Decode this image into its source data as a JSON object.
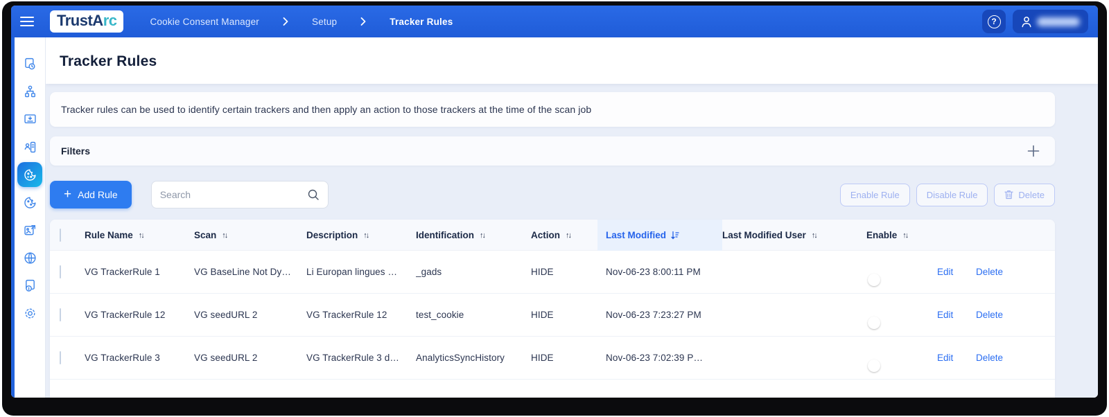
{
  "colors": {
    "navbar_blue": "#2263dc",
    "accent_blue": "#2e7cf0",
    "link_blue": "#2b6ef2",
    "active_sort_blue": "#2563eb",
    "sidebar_icon_blue": "#3f86ea"
  },
  "navbar": {
    "logo_part1": "TrustA",
    "logo_part2": "rc",
    "breadcrumb": [
      "Cookie Consent Manager",
      "Setup",
      "Tracker Rules"
    ],
    "help_glyph": "?"
  },
  "sidebar": {
    "items": [
      {
        "icon": "report-clock-icon",
        "active": false
      },
      {
        "icon": "sitemap-icon",
        "active": false
      },
      {
        "icon": "banner-download-icon",
        "active": false
      },
      {
        "icon": "audit-person-icon",
        "active": false
      },
      {
        "icon": "cookie-icon",
        "active": true
      },
      {
        "icon": "cookie-rules-icon",
        "active": false
      },
      {
        "icon": "export-card-icon",
        "active": false
      },
      {
        "icon": "globe-icon",
        "active": false
      },
      {
        "icon": "document-info-icon",
        "active": false
      },
      {
        "icon": "settings-gear-icon",
        "active": false
      }
    ]
  },
  "page": {
    "title": "Tracker Rules",
    "banner": "Tracker rules can be used to identify certain trackers and then apply an action to those trackers at the time of the scan job",
    "filters_label": "Filters",
    "filters_expand_glyph": "+"
  },
  "toolbar": {
    "add_rule_label": "Add Rule",
    "add_rule_plus": "+",
    "search_placeholder": "Search",
    "enable_rule_label": "Enable Rule",
    "disable_rule_label": "Disable Rule",
    "delete_label": "Delete"
  },
  "table": {
    "headers": [
      "Rule Name",
      "Scan",
      "Description",
      "Identification",
      "Action",
      "Last Modified",
      "Last Modified User",
      "Enable"
    ],
    "sort_glyph": "↑↓",
    "sorted_column": "Last Modified",
    "sort_direction": "desc",
    "row_actions": {
      "edit": "Edit",
      "delete": "Delete"
    },
    "rows": [
      {
        "rule_name": "VG TrackerRule 1",
        "scan": "VG BaseLine Not Dy…",
        "description": "Li Europan lingues …",
        "identification": "_gads",
        "action": "HIDE",
        "last_modified": "Nov-06-23 8:00:11 PM",
        "enabled": false
      },
      {
        "rule_name": "VG TrackerRule 12",
        "scan": "VG seedURL 2",
        "description": "VG TrackerRule 12",
        "identification": "test_cookie",
        "action": "HIDE",
        "last_modified": "Nov-06-23 7:23:27 PM",
        "enabled": false
      },
      {
        "rule_name": "VG TrackerRule 3",
        "scan": "VG seedURL 2",
        "description": "VG TrackerRule 3 d…",
        "identification": "AnalyticsSyncHistory",
        "action": "HIDE",
        "last_modified": "Nov-06-23 7:02:39 P…",
        "enabled": false
      }
    ]
  }
}
